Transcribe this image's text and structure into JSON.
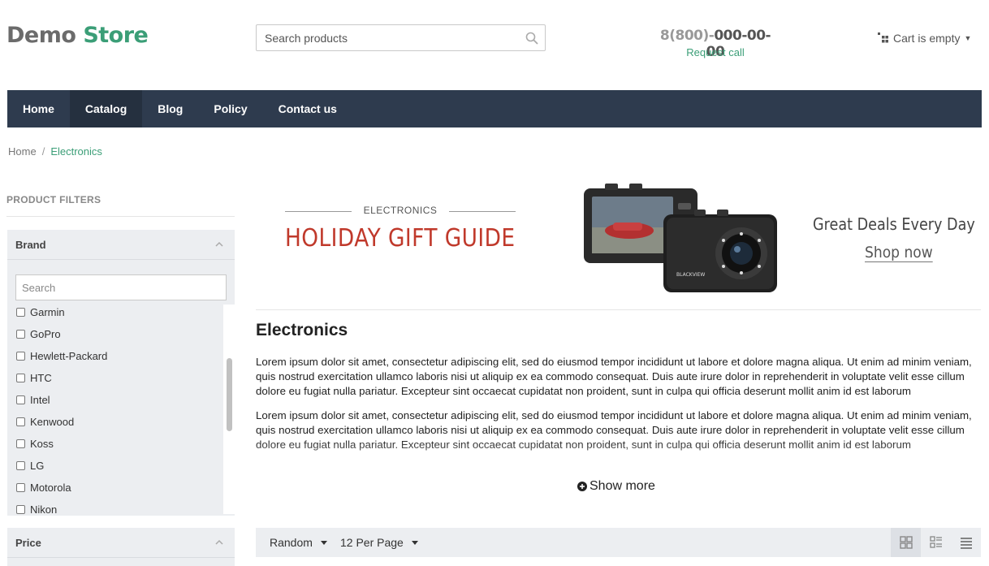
{
  "header": {
    "logo_part1": "Demo",
    "logo_part2": "Store",
    "search_placeholder": "Search products",
    "phone_prefix": "8(800)-",
    "phone_number": "000-00-00",
    "request_call": "Request call",
    "cart_label": "Cart is empty"
  },
  "nav": {
    "items": [
      {
        "label": "Home"
      },
      {
        "label": "Catalog"
      },
      {
        "label": "Blog"
      },
      {
        "label": "Policy"
      },
      {
        "label": "Contact us"
      }
    ],
    "active": "Catalog"
  },
  "breadcrumb": {
    "home": "Home",
    "separator": "/",
    "current": "Electronics"
  },
  "sidebar": {
    "title": "PRODUCT FILTERS",
    "brand": {
      "title": "Brand",
      "search_placeholder": "Search",
      "items": [
        "Garmin",
        "GoPro",
        "Hewlett-Packard",
        "HTC",
        "Intel",
        "Kenwood",
        "Koss",
        "LG",
        "Motorola",
        "Nikon"
      ]
    },
    "price": {
      "title": "Price"
    }
  },
  "banner": {
    "eyebrow": "ELECTRONICS",
    "title": "HOLIDAY GIFT GUIDE",
    "deals": "Great Deals Every Day",
    "cta": "Shop now",
    "product_label": "BLACKVIEW"
  },
  "category": {
    "title": "Electronics",
    "paragraphs": [
      "Lorem ipsum dolor sit amet, consectetur adipiscing elit, sed do eiusmod tempor incididunt ut labore et dolore magna aliqua. Ut enim ad minim veniam, quis nostrud exercitation ullamco laboris nisi ut aliquip ex ea commodo consequat. Duis aute irure dolor in reprehenderit in voluptate velit esse cillum dolore eu fugiat nulla pariatur. Excepteur sint occaecat cupidatat non proident, sunt in culpa qui officia deserunt mollit anim id est laborum",
      "Lorem ipsum dolor sit amet, consectetur adipiscing elit, sed do eiusmod tempor incididunt ut labore et dolore magna aliqua. Ut enim ad minim veniam, quis nostrud exercitation ullamco laboris nisi ut aliquip ex ea commodo consequat. Duis aute irure dolor in reprehenderit in voluptate velit esse cillum dolore eu fugiat nulla pariatur. Excepteur sint occaecat cupidatat non proident, sunt in culpa qui officia deserunt mollit anim id est laborum"
    ],
    "show_more": "Show more"
  },
  "toolbar": {
    "sort": "Random",
    "per_page": "12 Per Page",
    "views": [
      "grid-view-icon",
      "list-view-icon",
      "compact-list-icon"
    ],
    "active_view": "grid-view-icon"
  },
  "colors": {
    "accent": "#3b9e77",
    "nav_bg": "#2e3b4e",
    "banner_red": "#c0392b",
    "panel_bg": "#eceef1"
  }
}
